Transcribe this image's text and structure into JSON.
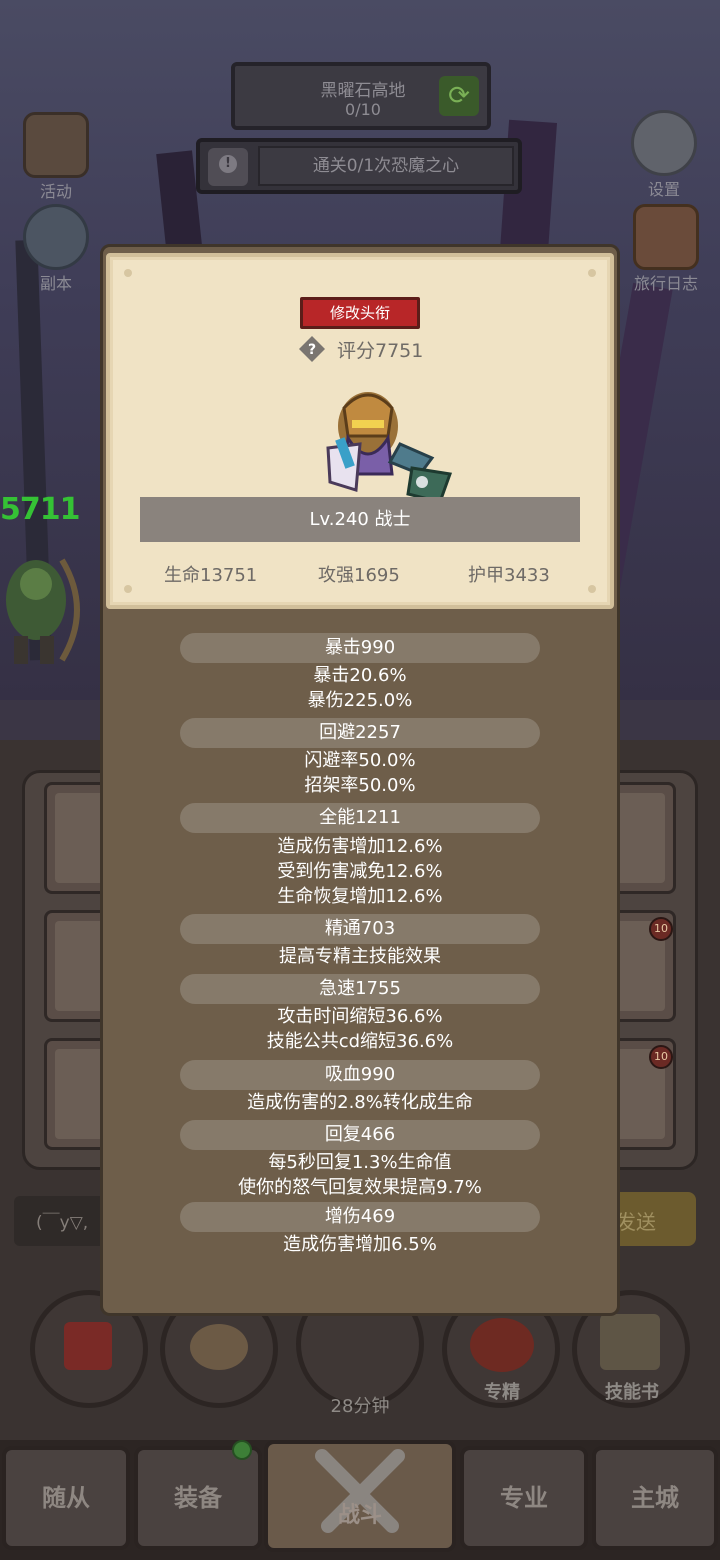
{
  "background": {
    "stage_name": "黑曜石高地",
    "stage_progress": "0/10",
    "quest_text": "通关0/1次恐魔之心",
    "left_menu": [
      {
        "label": "活动",
        "icon": "activity-board-icon"
      },
      {
        "label": "副本",
        "icon": "dungeon-portal-icon"
      }
    ],
    "right_menu": [
      {
        "label": "设置",
        "icon": "gear-icon"
      },
      {
        "label": "旅行日志",
        "icon": "travel-log-book-icon"
      }
    ],
    "side_score": "5711",
    "chat_placeholder": "(￣y▽,",
    "send_label": "发送",
    "action_circles": [
      {
        "label": "",
        "icon": "potion-icon"
      },
      {
        "label": "",
        "icon": "bread-icon"
      },
      {
        "label": "28分钟",
        "icon": "treasure-chest-icon"
      },
      {
        "label": "专精",
        "icon": "spec-target-icon"
      },
      {
        "label": "技能书",
        "icon": "skill-book-icon"
      }
    ],
    "equip_badges": [
      "10",
      "10"
    ],
    "tabs": [
      {
        "label": "随从",
        "active": false
      },
      {
        "label": "装备",
        "active": false
      },
      {
        "label": "战斗",
        "active": true
      },
      {
        "label": "专业",
        "active": false
      },
      {
        "label": "主城",
        "active": false
      }
    ]
  },
  "modal": {
    "title_button": "修改头衔",
    "score": "评分7751",
    "level_class": "Lv.240 战士",
    "base_stats": [
      "生命13751",
      "攻强1695",
      "护甲3433"
    ],
    "stat_groups": [
      {
        "header": "暴击990",
        "lines": [
          "暴击20.6%",
          "暴伤225.0%"
        ]
      },
      {
        "header": "回避2257",
        "lines": [
          "闪避率50.0%",
          "招架率50.0%"
        ]
      },
      {
        "header": "全能1211",
        "lines": [
          "造成伤害增加12.6%",
          "受到伤害减免12.6%",
          "生命恢复增加12.6%"
        ]
      },
      {
        "header": "精通703",
        "lines": [
          "提高专精主技能效果"
        ]
      },
      {
        "header": "急速1755",
        "lines": [
          "攻击时间缩短36.6%",
          "技能公共cd缩短36.6%"
        ]
      },
      {
        "header": "吸血990",
        "lines": [
          "造成伤害的2.8%转化成生命"
        ]
      },
      {
        "header": "回复466",
        "lines": [
          "每5秒回复1.3%生命值",
          "使你的怒气回复效果提高9.7%"
        ]
      },
      {
        "header": "增伤469",
        "lines": [
          "造成伤害增加6.5%"
        ]
      }
    ]
  }
}
